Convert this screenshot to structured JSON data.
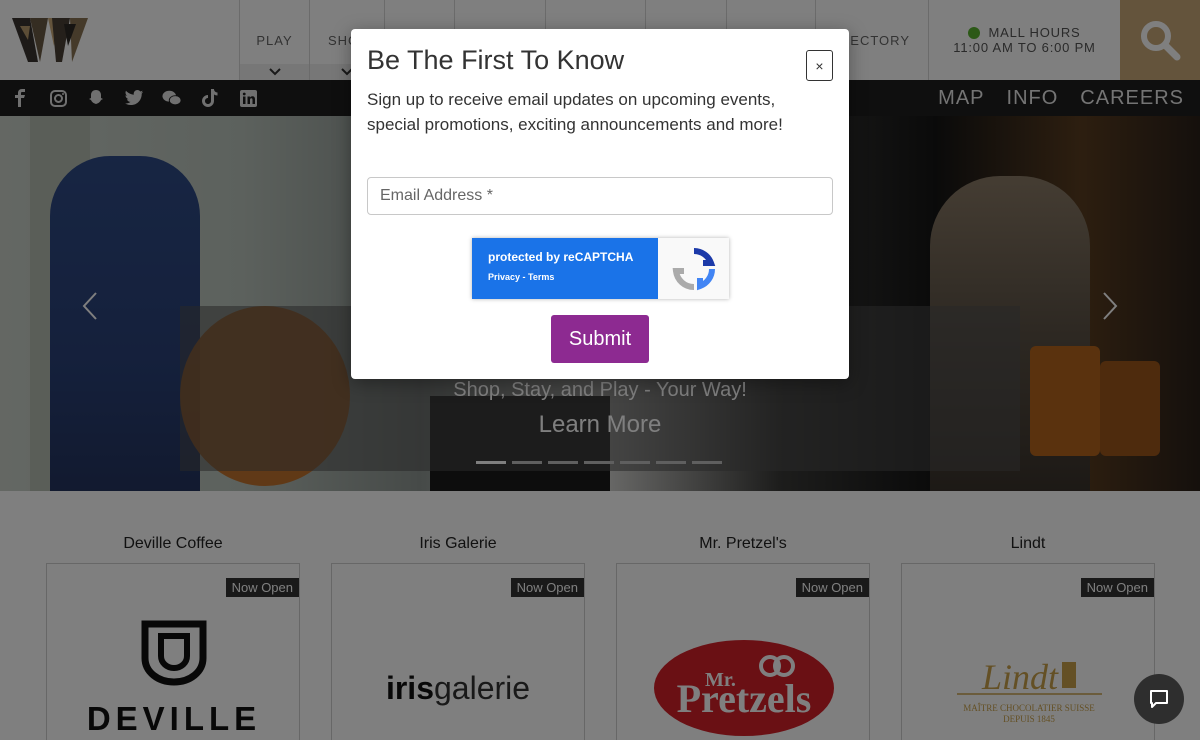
{
  "header": {
    "nav": [
      {
        "label": "PLAY"
      },
      {
        "label": "SHO"
      },
      {
        "label": ""
      },
      {
        "label": ""
      },
      {
        "label": ""
      },
      {
        "label": ""
      },
      {
        "label": ""
      },
      {
        "label": "RECTORY"
      }
    ],
    "hours_title": "MALL HOURS",
    "hours_time": "11:00 AM TO 6:00 PM"
  },
  "subbar": {
    "social_icons": [
      "facebook-icon",
      "instagram-icon",
      "snapchat-icon",
      "twitter-icon",
      "wechat-icon",
      "tiktok-icon",
      "linkedin-icon"
    ],
    "links": [
      "MAP",
      "INFO",
      "CAREERS"
    ]
  },
  "hero": {
    "subtitle": "Shop, Stay, and Play - Your Way!",
    "link": "Learn More",
    "slide_count": 7,
    "active_slide": 1
  },
  "stores": [
    {
      "name": "Deville Coffee",
      "badge": "Now Open",
      "logo_text": "DEVILLE"
    },
    {
      "name": "Iris Galerie",
      "badge": "Now Open",
      "logo_text_bold": "iris",
      "logo_text_light": "galerie"
    },
    {
      "name": "Mr. Pretzel's",
      "badge": "Now Open",
      "logo_text_small": "Mr.",
      "logo_text": "Pretzels"
    },
    {
      "name": "Lindt",
      "badge": "Now Open",
      "logo_text": "Lindt",
      "logo_sub1": "MAÎTRE CHOCOLATIER SUISSE",
      "logo_sub2": "DEPUIS 1845"
    }
  ],
  "modal": {
    "title": "Be The First To Know",
    "close": "×",
    "description": "Sign up to receive email updates on upcoming events, special promotions, exciting announcements and more!",
    "email_placeholder": "Email Address *",
    "captcha_line1": "protected by reCAPTCHA",
    "captcha_line2": "Privacy - Terms",
    "submit": "Submit"
  },
  "colors": {
    "accent_gold": "#c9a979",
    "submit_purple": "#8d2a91",
    "status_green": "#58b22f",
    "captcha_blue": "#1a73e8"
  }
}
